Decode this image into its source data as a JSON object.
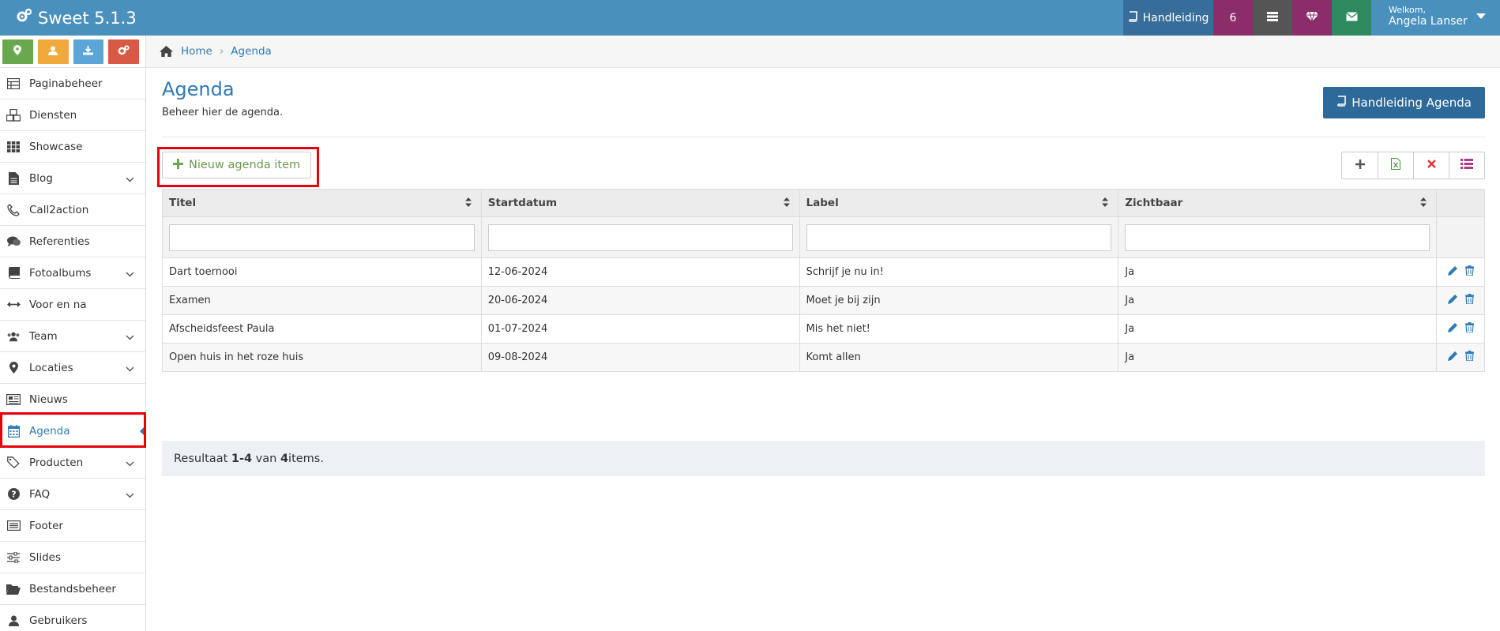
{
  "app": {
    "title": "Sweet 5.1.3"
  },
  "topbar": {
    "manual_label": "Handleiding",
    "notification_count": "6",
    "welcome": "Welkom,",
    "user_name": "Angela Lanser"
  },
  "sidebar": {
    "items": [
      {
        "label": "Paginabeheer",
        "icon": "table-icon",
        "has_children": false
      },
      {
        "label": "Diensten",
        "icon": "cubes-icon",
        "has_children": false
      },
      {
        "label": "Showcase",
        "icon": "grid-icon",
        "has_children": false
      },
      {
        "label": "Blog",
        "icon": "file-icon",
        "has_children": true
      },
      {
        "label": "Call2action",
        "icon": "phone-icon",
        "has_children": false
      },
      {
        "label": "Referenties",
        "icon": "comments-icon",
        "has_children": false
      },
      {
        "label": "Fotoalbums",
        "icon": "book-icon",
        "has_children": true
      },
      {
        "label": "Voor en na",
        "icon": "arrows-h-icon",
        "has_children": false
      },
      {
        "label": "Team",
        "icon": "users-icon",
        "has_children": true
      },
      {
        "label": "Locaties",
        "icon": "map-marker-icon",
        "has_children": true
      },
      {
        "label": "Nieuws",
        "icon": "newspaper-icon",
        "has_children": false
      },
      {
        "label": "Agenda",
        "icon": "calendar-icon",
        "has_children": false,
        "active": true
      },
      {
        "label": "Producten",
        "icon": "tags-icon",
        "has_children": true
      },
      {
        "label": "FAQ",
        "icon": "question-circle-icon",
        "has_children": true
      },
      {
        "label": "Footer",
        "icon": "list-alt-icon",
        "has_children": false
      },
      {
        "label": "Slides",
        "icon": "sliders-icon",
        "has_children": false
      },
      {
        "label": "Bestandsbeheer",
        "icon": "folder-open-icon",
        "has_children": false
      },
      {
        "label": "Gebruikers",
        "icon": "user-icon",
        "has_children": false
      }
    ]
  },
  "breadcrumb": {
    "home": "Home",
    "current": "Agenda"
  },
  "page": {
    "title": "Agenda",
    "subtitle": "Beheer hier de agenda.",
    "manual_button": "Handleiding Agenda",
    "new_button": "Nieuw agenda item"
  },
  "table": {
    "columns": [
      "Titel",
      "Startdatum",
      "Label",
      "Zichtbaar"
    ],
    "rows": [
      [
        "Dart toernooi",
        "12-06-2024",
        "Schrijf je nu in!",
        "Ja"
      ],
      [
        "Examen",
        "20-06-2024",
        "Moet je bij zijn",
        "Ja"
      ],
      [
        "Afscheidsfeest Paula",
        "01-07-2024",
        "Mis het niet!",
        "Ja"
      ],
      [
        "Open huis in het roze huis",
        "09-08-2024",
        "Komt allen",
        "Ja"
      ]
    ],
    "summary_prefix": "Resultaat ",
    "summary_range": "1-4",
    "summary_mid": " van ",
    "summary_total": "4",
    "summary_suffix": " items."
  },
  "colors": {
    "topbar": "#4a90bd",
    "accent": "#2f7ab5",
    "highlight": "#e8000b"
  }
}
